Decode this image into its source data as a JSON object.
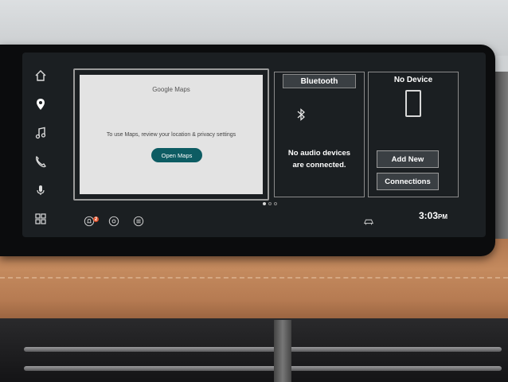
{
  "colors": {
    "accent": "#0d5c63",
    "screen_bg": "#1b1f22",
    "card_border": "#8a8a8a",
    "badge": "#e0512b"
  },
  "rail": {
    "items": [
      {
        "name": "home-icon"
      },
      {
        "name": "location-pin-icon"
      },
      {
        "name": "music-note-icon"
      },
      {
        "name": "phone-icon"
      },
      {
        "name": "microphone-icon"
      },
      {
        "name": "app-grid-icon"
      }
    ]
  },
  "maps": {
    "logo_google": "Google",
    "logo_maps": "Maps",
    "message": "To use Maps, review your location & privacy settings",
    "button_label": "Open Maps"
  },
  "bluetooth": {
    "title": "Bluetooth",
    "message_line1": "No audio devices",
    "message_line2": "are connected.",
    "icon": "bluetooth-icon"
  },
  "device": {
    "title": "No Device",
    "icon": "phone-outline-icon",
    "add_new_label": "Add New",
    "connections_label": "Connections"
  },
  "pager": {
    "pages": 3,
    "active_index": 0
  },
  "status_bar": {
    "notification_count": "2",
    "time": "3:03",
    "ampm": "PM",
    "icons": [
      "notifications-icon",
      "settings-gear-icon",
      "equalizer-icon",
      "car-icon"
    ]
  }
}
